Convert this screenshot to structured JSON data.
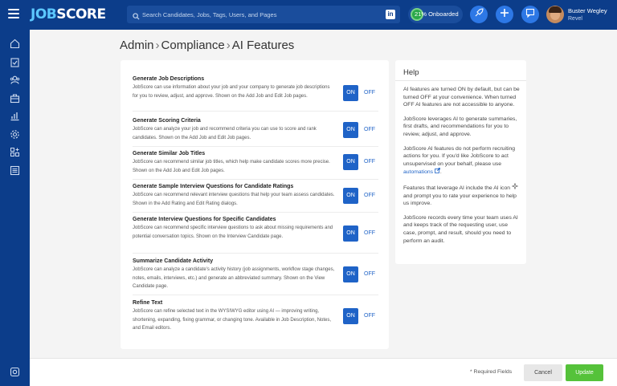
{
  "app": {
    "logo_prefix": "JOB",
    "logo_suffix": "SCORE"
  },
  "search": {
    "placeholder": "Search Candidates, Jobs, Tags, Users, and Pages"
  },
  "header": {
    "onboarded_label": "21% Onboarded",
    "onboarded_percent": 21,
    "user_name": "Buster Wegley",
    "user_org": "Revel",
    "icons": [
      "hamburger-icon",
      "search-icon",
      "linkedin-icon",
      "rocket-icon",
      "plus-icon",
      "chat-icon"
    ]
  },
  "sidebar": {
    "items": [
      {
        "icon": "home-icon"
      },
      {
        "icon": "clipboard-icon"
      },
      {
        "icon": "users-icon"
      },
      {
        "icon": "briefcase-icon"
      },
      {
        "icon": "chart-icon"
      },
      {
        "icon": "gear-icon"
      },
      {
        "icon": "apps-icon"
      },
      {
        "icon": "list-icon"
      },
      {
        "icon": "settings-bottom-icon"
      }
    ]
  },
  "breadcrumb": {
    "part1": "Admin",
    "part2": "Compliance",
    "part3": "AI Features",
    "sep": "›"
  },
  "features": [
    {
      "title": "Generate Job Descriptions",
      "desc": "JobScore can use information about your job and your company to generate job descriptions for you to review, adjust, and approve. Shown on the Add Job and Edit Job pages.",
      "on": "ON",
      "off": "OFF",
      "enabled": true
    },
    {
      "title": "Generate Scoring Criteria",
      "desc": "JobScore can analyze your job and recommend criteria you can use to score and rank candidates. Shown on the Add Job and Edit Job pages.",
      "on": "ON",
      "off": "OFF",
      "enabled": true
    },
    {
      "title": "Generate Similar Job Titles",
      "desc": "JobScore can recommend similar job titles, which help make candidate scores more precise. Shown on the Add Job and Edit Job pages.",
      "on": "ON",
      "off": "OFF",
      "enabled": true
    },
    {
      "title": "Generate Sample Interview Questions for Candidate Ratings",
      "desc": "JobScore can recommend relevant interview questions that help your team assess candidates. Shown in the Add Rating and Edit Rating dialogs.",
      "on": "ON",
      "off": "OFF",
      "enabled": true
    },
    {
      "title": "Generate Interview Questions for Specific Candidates",
      "desc": "JobScore can recommend specific interview questions to ask about missing requirements and potential conversation topics. Shown on the Interview Candidate page.",
      "on": "ON",
      "off": "OFF",
      "enabled": true
    },
    {
      "title": "Summarize Candidate Activity",
      "desc": "JobScore can analyze a candidate's activity history (job assignments, workflow stage changes, notes, emails, interviews, etc.) and generate an abbreviated summary. Shown on the View Candidate page.",
      "on": "ON",
      "off": "OFF",
      "enabled": true
    },
    {
      "title": "Refine Text",
      "desc": "JobScore can refine selected text in the WYSIWYG editor using AI — improving writing, shortening, expanding, fixing grammar, or changing tone. Available in Job Description, Notes, and Email editors.",
      "on": "ON",
      "off": "OFF",
      "enabled": true
    }
  ],
  "help": {
    "title": "Help",
    "p1": "AI features are turned ON by default, but can be turned OFF at your convenience. When turned OFF AI features are not accessible to anyone.",
    "p2": "JobScore leverages AI to generate summaries, first drafts, and recommendations for you to review, adjust, and approve.",
    "p3_pre": "JobScore AI features do not perform recruiting actions for you. If you'd like JobScore to act unsupervised on your behalf, please use ",
    "p3_link": "automations",
    "p3_post": ".",
    "p4_pre": "Features that leverage AI include the AI icon ",
    "p4_post": " and prompt you to rate your experience to help us improve.",
    "p5": "JobScore records every time your team uses AI and keeps track of the requesting user, use case, prompt, and result, should you need to perform an audit."
  },
  "footer": {
    "required": "* Required Fields",
    "cancel": "Cancel",
    "update": "Update"
  },
  "colors": {
    "navy": "#0c3d8a",
    "accent": "#1f63c7",
    "update_green": "#55c23a"
  }
}
